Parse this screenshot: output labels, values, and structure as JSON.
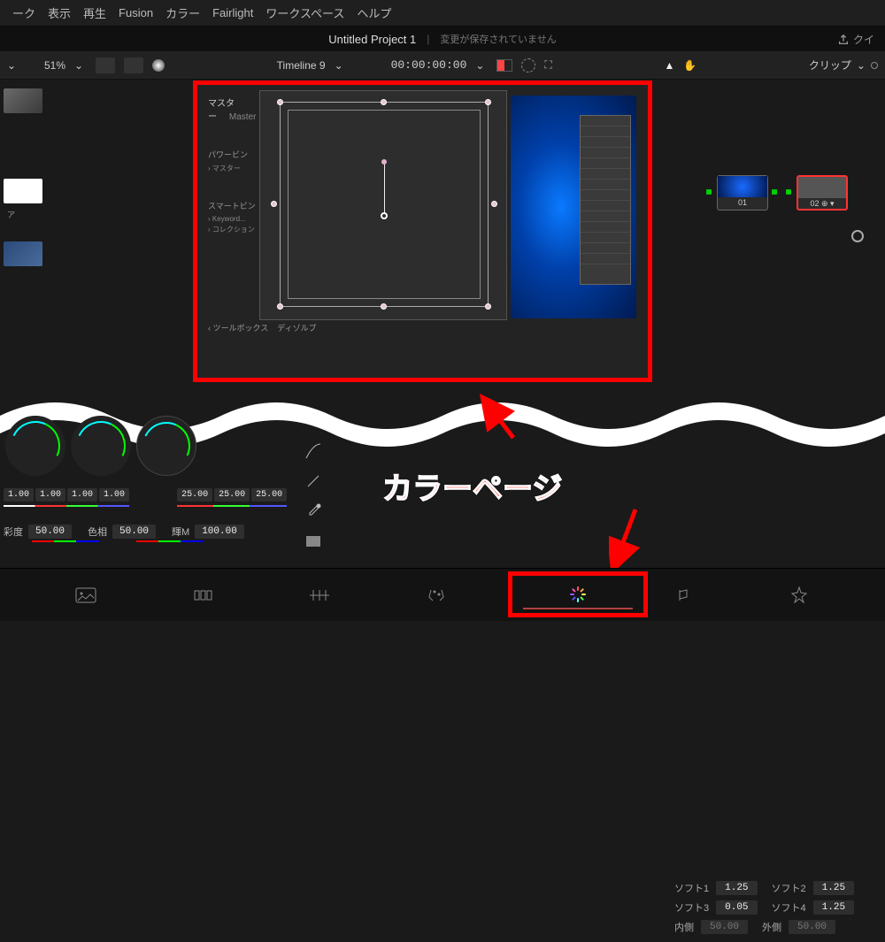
{
  "menu": {
    "items": [
      "ーク",
      "表示",
      "再生",
      "Fusion",
      "カラー",
      "Fairlight",
      "ワークスペース",
      "ヘルプ"
    ]
  },
  "project": {
    "title": "Untitled Project 1",
    "status": "変更が保存されていません",
    "share": "クイ"
  },
  "toolbar": {
    "zoom": "51%",
    "timeline": "Timeline 9",
    "timecode": "00:00:00:00",
    "clip_label": "クリップ"
  },
  "viewer_panel": {
    "master_jp": "マスター",
    "master_en": "Master",
    "powerbin": "パワービン",
    "powerbin_item": "マスター",
    "smartbin": "スマートビン",
    "smartbin_k": "Keyword...",
    "smartbin_c": "コレクション",
    "bottom_tool": "ツールボックス",
    "bottom_dissolve": "ディゾルブ"
  },
  "transport": {
    "timecode": "00:00:00:00"
  },
  "nodes": {
    "n1": "01",
    "n2": "02"
  },
  "wheels": {
    "row1": [
      "1.00",
      "1.00",
      "1.00",
      "1.00"
    ],
    "row2": [
      "25.00",
      "25.00",
      "25.00"
    ],
    "saturation_label": "彩度",
    "saturation_value": "50.00",
    "hue_label": "色相",
    "hue_value": "50.00",
    "lum_label": "輝M",
    "lum_value": "100.00"
  },
  "soft": {
    "s1l": "ソフト1",
    "s1v": "1.25",
    "s2l": "ソフト2",
    "s2v": "1.25",
    "s3l": "ソフト3",
    "s3v": "0.05",
    "s4l": "ソフト4",
    "s4v": "1.25",
    "inl": "内側",
    "inv": "50.00",
    "outl": "外側",
    "outv": "50.00"
  },
  "annotation": "カラーページ"
}
